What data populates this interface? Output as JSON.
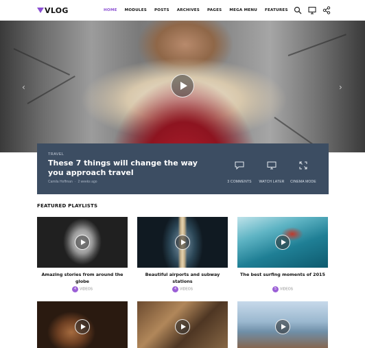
{
  "brand": {
    "logo_text": "VLOG",
    "accent": "#8b4fd2"
  },
  "nav": {
    "items": [
      "HOME",
      "MODULES",
      "POSTS",
      "ARCHIVES",
      "PAGES",
      "MEGA MENU",
      "FEATURES"
    ],
    "active": "HOME"
  },
  "header_icons": [
    "search-icon",
    "monitor-icon",
    "share-icon"
  ],
  "hero": {
    "prev_arrow": "‹",
    "next_arrow": "›",
    "feature": {
      "category": "TRAVEL",
      "title": "These 7 things will change the way you approach travel",
      "author": "Camila Hoffman",
      "date": "2 weeks ago",
      "actions": [
        {
          "label": "3 COMMENTS",
          "icon": "comment-icon"
        },
        {
          "label": "WATCH LATER",
          "icon": "monitor-icon"
        },
        {
          "label": "CINEMA MODE",
          "icon": "expand-icon"
        }
      ]
    }
  },
  "playlists": {
    "title": "FEATURED PLAYLISTS",
    "items": [
      {
        "title": "Amazing stories from around the globe",
        "count": "4",
        "count_label": "VIDEOS"
      },
      {
        "title": "Beautiful airports and subway stations",
        "count": "4",
        "count_label": "VIDEOS"
      },
      {
        "title": "The best surfing moments of 2015",
        "count": "5",
        "count_label": "VIDEOS"
      },
      {
        "title": "",
        "count": "",
        "count_label": ""
      },
      {
        "title": "",
        "count": "",
        "count_label": ""
      },
      {
        "title": "",
        "count": "",
        "count_label": ""
      }
    ]
  }
}
